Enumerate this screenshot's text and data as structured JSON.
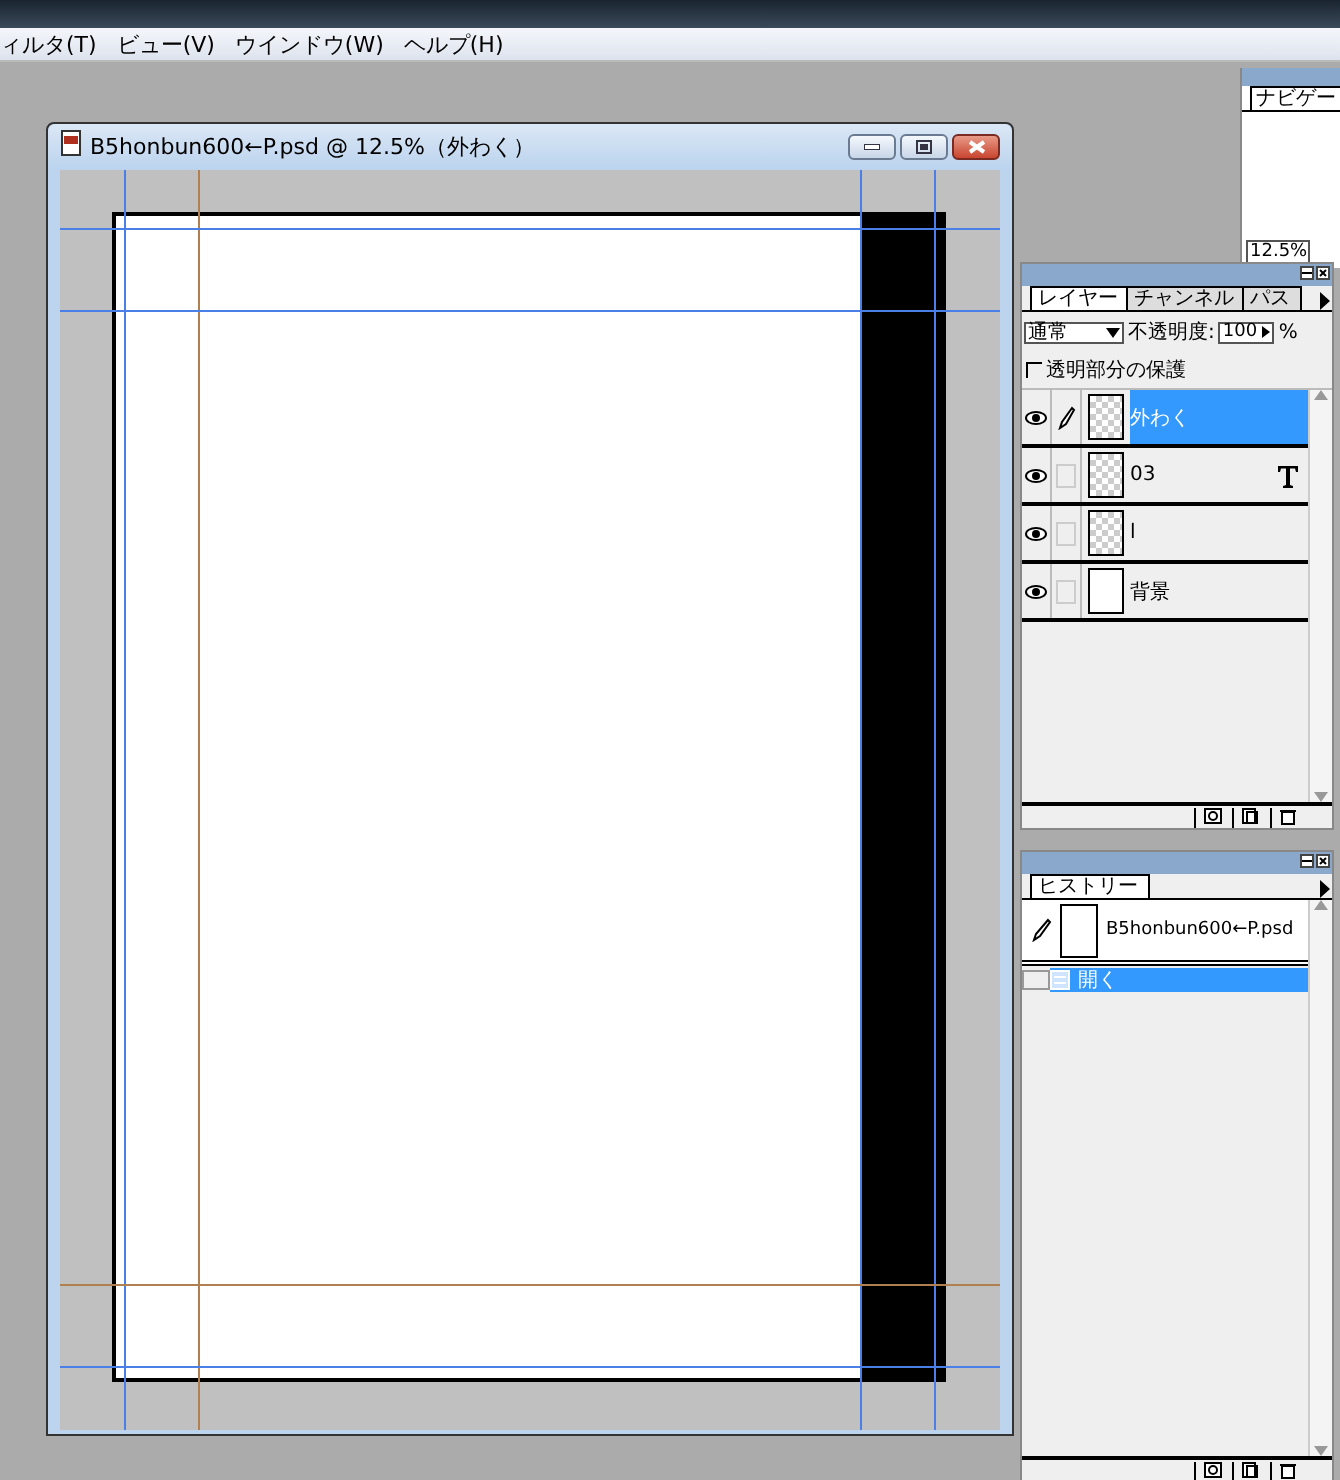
{
  "menu_bar": {
    "items": [
      "ィルタ(T)",
      "ビュー(V)",
      "ウインドウ(W)",
      "ヘルプ(H)"
    ]
  },
  "navigator_panel": {
    "tab": "ナビゲー",
    "zoom": "12.5%"
  },
  "document_window": {
    "title": "B5honbun600←P.psd @ 12.5%（外わく）"
  },
  "layers_panel": {
    "tabs": [
      {
        "label": "レイヤー",
        "selected": true
      },
      {
        "label": "チャンネル",
        "selected": false
      },
      {
        "label": "パス",
        "selected": false
      }
    ],
    "blend_mode": "通常",
    "opacity_label": "不透明度:",
    "opacity": "100",
    "percent": "%",
    "preserve_transparency": {
      "label": "透明部分の保護",
      "checked": false
    },
    "layers": [
      {
        "name": "外わく",
        "kind": "pixel",
        "selected": true,
        "visible": true
      },
      {
        "name": "03",
        "kind": "text",
        "selected": false,
        "visible": true
      },
      {
        "name": "l",
        "kind": "pixel",
        "selected": false,
        "visible": true
      },
      {
        "name": "背景",
        "kind": "background",
        "selected": false,
        "visible": true
      }
    ]
  },
  "history_panel": {
    "tabs": [
      {
        "label": "ヒストリー",
        "selected": true
      }
    ],
    "snapshot": "B5honbun600←P.psd",
    "states": [
      {
        "label": "開く",
        "selected": true
      }
    ]
  }
}
